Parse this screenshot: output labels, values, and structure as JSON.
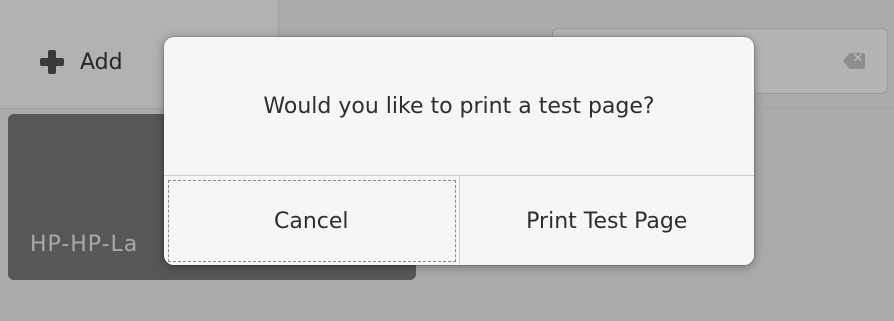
{
  "toolbar": {
    "add_label": "Add",
    "search_placeholder": ""
  },
  "printers": [
    {
      "name": "HP-HP-La"
    }
  ],
  "dialog": {
    "message": "Would you like to print a test page?",
    "cancel_label": "Cancel",
    "confirm_label": "Print Test Page"
  },
  "icons": {
    "add": "plus-icon",
    "clear": "backspace-icon"
  },
  "colors": {
    "backdrop": "#ababab",
    "dialog_bg": "#f6f6f6",
    "tile_bg": "#575757"
  }
}
